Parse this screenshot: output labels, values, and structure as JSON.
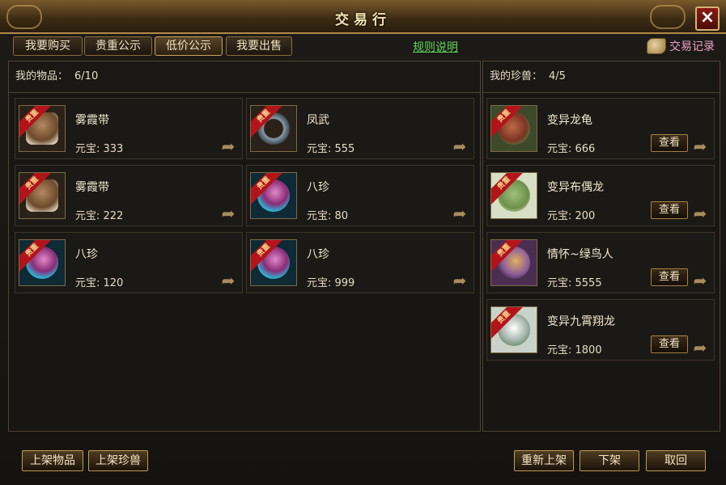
{
  "window": {
    "title": "交易行"
  },
  "tabs": [
    {
      "label": "我要购买"
    },
    {
      "label": "贵重公示"
    },
    {
      "label": "低价公示"
    },
    {
      "label": "我要出售"
    }
  ],
  "rules_link": "规则说明",
  "record_link": "交易记录",
  "items_panel": {
    "header_label": "我的物品：",
    "count": "6/10",
    "items": [
      {
        "name": "雾霞带",
        "price": "元宝: 333",
        "badge": "贵重"
      },
      {
        "name": "凤武",
        "price": "元宝: 555",
        "badge": "贵重"
      },
      {
        "name": "雾霞带",
        "price": "元宝: 222",
        "badge": "贵重"
      },
      {
        "name": "八珍",
        "price": "元宝: 80",
        "badge": "贵重"
      },
      {
        "name": "八珍",
        "price": "元宝: 120",
        "badge": "贵重"
      },
      {
        "name": "八珍",
        "price": "元宝: 999",
        "badge": "贵重"
      }
    ]
  },
  "pets_panel": {
    "header_label": "我的珍兽：",
    "count": "4/5",
    "pets": [
      {
        "name": "变异龙龟",
        "price": "元宝: 666",
        "badge": "贵重",
        "view_label": "查看"
      },
      {
        "name": "变异布偶龙",
        "price": "元宝: 200",
        "badge": "贵重",
        "view_label": "查看"
      },
      {
        "name": "情怀~绿鸟人",
        "price": "元宝: 5555",
        "badge": "贵重",
        "view_label": "查看"
      },
      {
        "name": "变异九霄翔龙",
        "price": "元宝: 1800",
        "badge": "贵重",
        "view_label": "查看"
      }
    ]
  },
  "bottom": {
    "list_item": "上架物品",
    "list_pet": "上架珍兽",
    "relist": "重新上架",
    "delist": "下架",
    "cancel": "取回"
  },
  "colors": {
    "accent_gold": "#c19b55",
    "badge_red": "#b3141a",
    "link_green": "#5fd45a",
    "record_pink": "#f0a0c8"
  }
}
